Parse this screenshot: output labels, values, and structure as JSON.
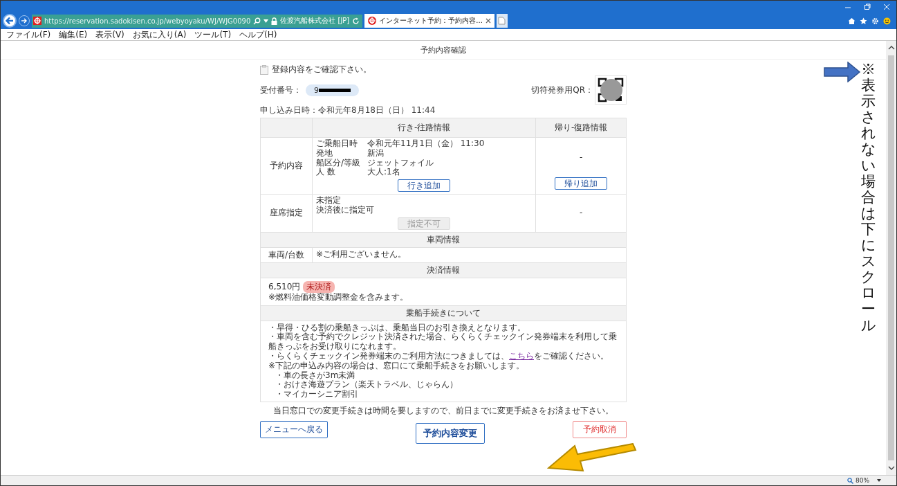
{
  "browser": {
    "url": "https://reservation.sadokisen.co.jp/webyoyaku/WJ/WJG0090",
    "site_identity": "佐渡汽船株式会社 [JP]",
    "tabs": [
      {
        "title": "インターネット予約：予約内容...",
        "selected": true
      }
    ],
    "menu": [
      "ファイル(F)",
      "編集(E)",
      "表示(V)",
      "お気に入り(A)",
      "ツール(T)",
      "ヘルプ(H)"
    ],
    "zoom": "80%"
  },
  "page": {
    "title": "予約内容確認",
    "intro": "登録内容をご確認下さい。",
    "receipt_label": "受付番号：",
    "receipt_number": "9",
    "qr_label": "切符発券用QR：",
    "applied_at": "申し込み日時：令和元年8月18日（日） 11:44",
    "table": {
      "columns": [
        "行き-往路情報",
        "帰り-復路情報"
      ],
      "reservation": {
        "label": "予約内容",
        "outbound": [
          {
            "key": "ご乗船日時",
            "value": "令和元年11月1日（金） 11:30"
          },
          {
            "key": "発地",
            "value": "新潟"
          },
          {
            "key": "船区分/等級",
            "value": "ジェットフォイル"
          },
          {
            "key": "人 数",
            "value": "大人:1名"
          }
        ],
        "outbound_button": "行き追加",
        "return": "-",
        "return_button": "帰り追加"
      },
      "seats": {
        "label": "座席指定",
        "outbound_lines": [
          "未指定",
          "決済後に指定可"
        ],
        "button": {
          "label": "指定不可",
          "disabled": true
        },
        "return": "-"
      },
      "vehicle": {
        "heading": "車両情報",
        "label": "車両/台数",
        "value": "※ご利用ございません。"
      },
      "payment": {
        "heading": "決済情報",
        "amount": "6,510円",
        "status": "未決済",
        "note": "※燃料油価格変動調整金を含みます。"
      },
      "boarding": {
        "heading": "乗船手続きについて",
        "lines": [
          {
            "text": "・早得・ひる割の乗船きっぷは、乗船当日のお引き換えとなります。",
            "indent": false
          },
          {
            "text": "・車両を含む予約でクレジット決済された場合、らくらくチェックイン発券端末を利用して乗船きっぷをお受け取りになれます。",
            "indent": false
          },
          {
            "text": "・らくらくチェックイン発券端末のご利用方法につきましては、",
            "link": "こちら",
            "text_after": "をご確認ください。",
            "indent": false
          },
          {
            "text": "※下記の申込み内容の場合は、窓口にて乗船手続きをお願いします。",
            "indent": false
          },
          {
            "text": "・車の長さが3m未満",
            "indent": true
          },
          {
            "text": "・おけさ海遊プラン（楽天トラベル、じゃらん）",
            "indent": true
          },
          {
            "text": "・マイカーシニア割引",
            "indent": true
          }
        ]
      }
    },
    "notice": "当日窓口での変更手続きは時間を要しますので、前日までに変更手続きをお済ませ下さい。",
    "buttons": {
      "back": "メニューへ戻る",
      "change": "予約内容変更",
      "cancel": "予約取消"
    }
  },
  "annotation": {
    "text": "※表示されない場合は下にスクロール"
  }
}
